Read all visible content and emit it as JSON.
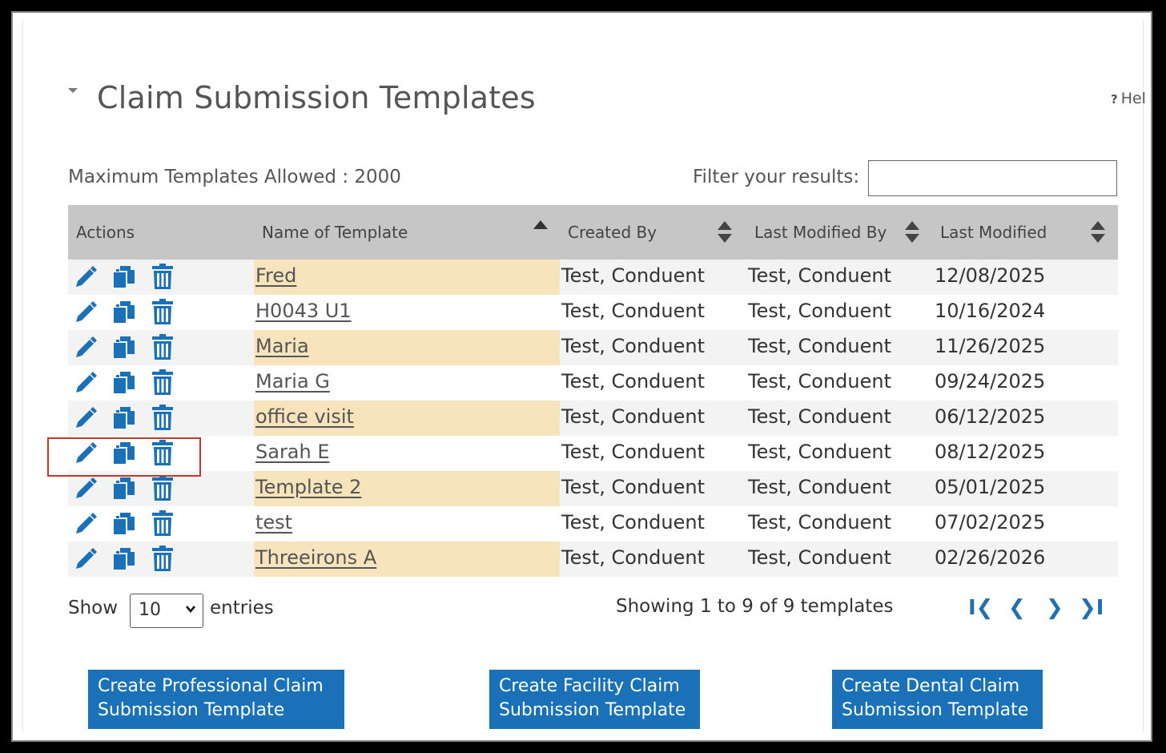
{
  "header": {
    "title": "Claim Submission Templates",
    "help_label": "Hel",
    "help_prefix": "?"
  },
  "toolbar": {
    "max_templates": "Maximum Templates Allowed : 2000",
    "filter_label": "Filter your results:",
    "filter_value": ""
  },
  "table": {
    "columns": [
      "Actions",
      "Name of Template",
      "Created By",
      "Last Modified By",
      "Last Modified"
    ],
    "rows": [
      {
        "name": "Fred",
        "created_by": "Test, Conduent",
        "modified_by": "Test, Conduent",
        "modified": "12/08/2025"
      },
      {
        "name": "H0043 U1",
        "created_by": "Test, Conduent",
        "modified_by": "Test, Conduent",
        "modified": "10/16/2024"
      },
      {
        "name": "Maria",
        "created_by": "Test, Conduent",
        "modified_by": "Test, Conduent",
        "modified": "11/26/2025"
      },
      {
        "name": "Maria G",
        "created_by": "Test, Conduent",
        "modified_by": "Test, Conduent",
        "modified": "09/24/2025"
      },
      {
        "name": "office visit",
        "created_by": "Test, Conduent",
        "modified_by": "Test, Conduent",
        "modified": "06/12/2025"
      },
      {
        "name": "Sarah E",
        "created_by": "Test, Conduent",
        "modified_by": "Test, Conduent",
        "modified": "08/12/2025"
      },
      {
        "name": "Template 2",
        "created_by": "Test, Conduent",
        "modified_by": "Test, Conduent",
        "modified": "05/01/2025"
      },
      {
        "name": "test",
        "created_by": "Test, Conduent",
        "modified_by": "Test, Conduent",
        "modified": "07/02/2025"
      },
      {
        "name": "Threeirons A",
        "created_by": "Test, Conduent",
        "modified_by": "Test, Conduent",
        "modified": "02/26/2026"
      }
    ],
    "action_icons": [
      "edit-icon",
      "copy-icon",
      "delete-icon"
    ]
  },
  "footer": {
    "show_label": "Show",
    "entries_value": "10",
    "entries_label": "entries",
    "showing_text": "Showing 1 to 9 of 9 templates",
    "pager": {
      "first": "I❮",
      "prev": "❮",
      "next": "❯",
      "last": "❯I"
    }
  },
  "buttons": {
    "professional_line1": "Create Professional Claim",
    "professional_line2": "Submission Template",
    "facility_line1": "Create Facility Claim",
    "facility_line2": "Submission Template",
    "dental_line1": "Create Dental Claim",
    "dental_line2": "Submission Template"
  },
  "colors": {
    "accent": "#1a71b8",
    "row_highlight": "#f7e4bd",
    "header_bg": "#c6c6c6",
    "annotation_box": "#c0392b"
  }
}
